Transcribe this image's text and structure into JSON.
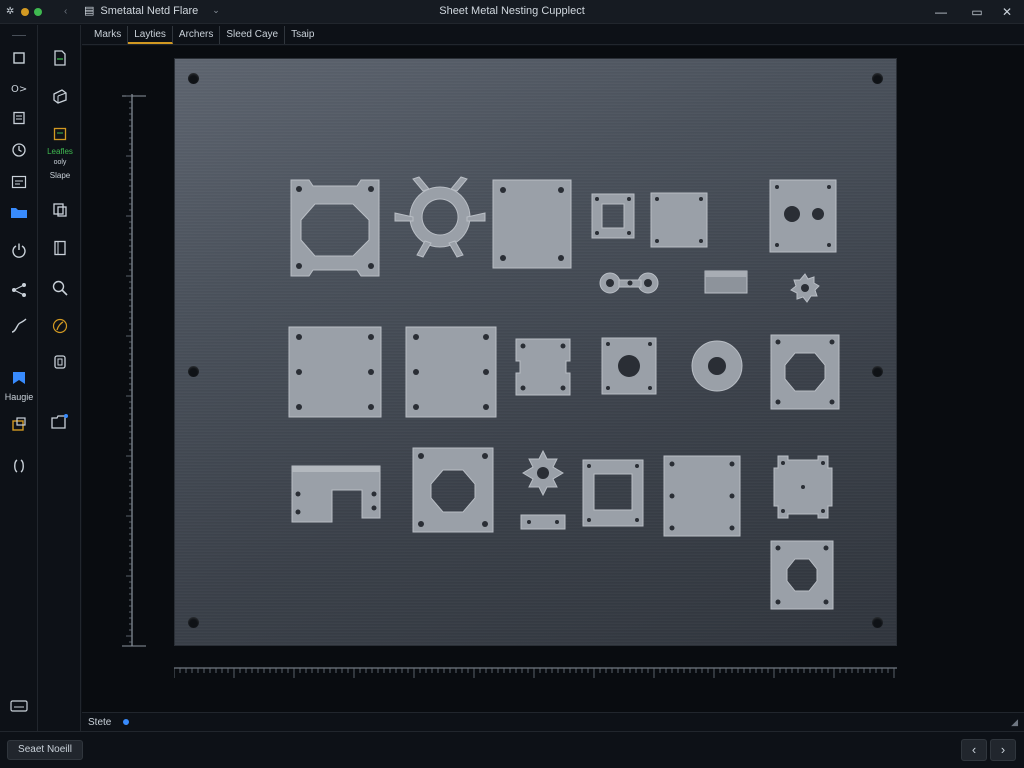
{
  "window": {
    "title": "Sheet Metal Nesting Cupplect",
    "document_tab": "Smetatal Netd Flare",
    "controls": [
      "minimize",
      "maximize",
      "close"
    ]
  },
  "tabs": [
    {
      "label": "Marks",
      "active": false
    },
    {
      "label": "Layties",
      "active": true
    },
    {
      "label": "Archers",
      "active": false
    },
    {
      "label": "Sleed Caye",
      "active": false
    },
    {
      "label": "Tsaip",
      "active": false
    }
  ],
  "rail": {
    "items": [
      {
        "icon": "square-icon"
      },
      {
        "icon": "link-icon"
      },
      {
        "icon": "document-icon"
      },
      {
        "icon": "clock-icon"
      },
      {
        "icon": "grid-icon"
      },
      {
        "icon": "folder-icon",
        "active": true
      },
      {
        "icon": "power-icon"
      },
      {
        "icon": "share-icon"
      },
      {
        "icon": "curve-icon"
      },
      {
        "icon": "bookmark-icon",
        "active": true,
        "label": "Haugie"
      },
      {
        "icon": "layers-icon"
      },
      {
        "icon": "code-icon"
      },
      {
        "icon": "keyboard-icon"
      }
    ]
  },
  "panel2": {
    "items": [
      {
        "icon": "file-icon"
      },
      {
        "icon": "cube-icon"
      },
      {
        "icon": "sheet-icon",
        "label1": "Leafles",
        "label2": "ooly",
        "label3": "Slape"
      },
      {
        "icon": "copy-icon"
      },
      {
        "icon": "book-icon"
      },
      {
        "icon": "search-icon"
      },
      {
        "icon": "brush-icon"
      },
      {
        "icon": "stack-icon"
      },
      {
        "icon": "folder-open-icon"
      }
    ]
  },
  "status": {
    "label": "Stete"
  },
  "bottom": {
    "button_label": "Seaet Noeill",
    "prev": "‹",
    "next": "›"
  },
  "colors": {
    "accent": "#388bfd",
    "tab_underline": "#d29922",
    "background": "#0d1117"
  }
}
